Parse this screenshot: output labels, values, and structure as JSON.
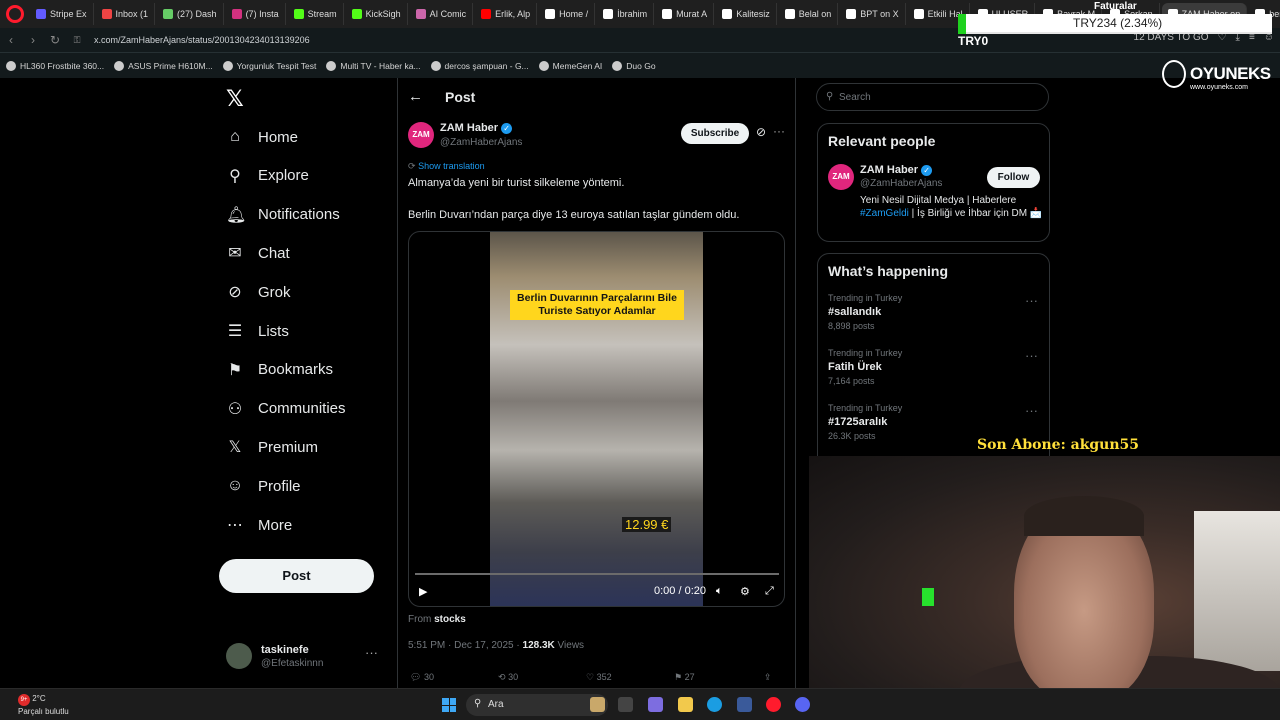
{
  "browser": {
    "tabs": [
      {
        "label": "Stripe Ex",
        "color": "#635bff"
      },
      {
        "label": "Inbox (1",
        "color": "#e44"
      },
      {
        "label": "(27) Dash",
        "color": "#6c6"
      },
      {
        "label": "(7) Insta",
        "color": "#d2317f"
      },
      {
        "label": "Stream",
        "color": "#53fc18"
      },
      {
        "label": "KickSigh",
        "color": "#53fc18"
      },
      {
        "label": "AI Comic",
        "color": "#c6a"
      },
      {
        "label": "Erlik, Alp",
        "color": "#f00"
      },
      {
        "label": "Home /",
        "color": "#fff"
      },
      {
        "label": "İbrahim",
        "color": "#fff"
      },
      {
        "label": "Murat A",
        "color": "#fff"
      },
      {
        "label": "Kalitesiz",
        "color": "#fff"
      },
      {
        "label": "Belal on",
        "color": "#fff"
      },
      {
        "label": "BPT on X",
        "color": "#fff"
      },
      {
        "label": "Etkili Hal",
        "color": "#fff"
      },
      {
        "label": "ULUSER",
        "color": "#fff"
      },
      {
        "label": "Bayrak M",
        "color": "#fff"
      },
      {
        "label": "Serkan",
        "color": "#fff"
      },
      {
        "label": "ZAM Haber on",
        "color": "#fff"
      },
      {
        "label": "berkay",
        "color": "#fff"
      }
    ],
    "url": "x.com/ZamHaberAjans/status/2001304234013139206",
    "nav_right_text": "12 DAYS TO GO",
    "bookmarks": [
      "HL360 Frostbite 360...",
      "ASUS Prime H610M...",
      "Yorgunluk Tespit Test",
      "Multi TV - Haber ka...",
      "dercos şampuan - G...",
      "MemeGen AI",
      "Duo Go"
    ]
  },
  "overlay": {
    "stock": "TRY234 (2.34%)",
    "ticker_label": "TRY0",
    "faturalar": "Faturalar",
    "brand": "OYUNEKS",
    "brand_url": "www.oyuneks.com",
    "son_abone": "Son Abone: akgun55"
  },
  "sidebar": {
    "items": [
      {
        "label": "Home",
        "icon": "home-icon",
        "glyph": "⌂"
      },
      {
        "label": "Explore",
        "icon": "search-icon",
        "glyph": "⚲"
      },
      {
        "label": "Notifications",
        "icon": "bell-icon",
        "glyph": "🔔︎"
      },
      {
        "label": "Chat",
        "icon": "mail-icon",
        "glyph": "✉"
      },
      {
        "label": "Grok",
        "icon": "grok-icon",
        "glyph": "⊘"
      },
      {
        "label": "Lists",
        "icon": "list-icon",
        "glyph": "☰"
      },
      {
        "label": "Bookmarks",
        "icon": "bookmark-icon",
        "glyph": "⚑"
      },
      {
        "label": "Communities",
        "icon": "communities-icon",
        "glyph": "⚇"
      },
      {
        "label": "Premium",
        "icon": "x-logo-icon",
        "glyph": "𝕏"
      },
      {
        "label": "Profile",
        "icon": "person-icon",
        "glyph": "☺"
      },
      {
        "label": "More",
        "icon": "more-circle-icon",
        "glyph": "⋯"
      }
    ],
    "post_button": "Post",
    "account": {
      "name": "taskinefe",
      "handle": "@Efetaskinnn"
    }
  },
  "post": {
    "header": "Post",
    "author_name": "ZAM Haber",
    "author_avatar_text": "ZAM",
    "author_handle": "@ZamHaberAjans",
    "subscribe_label": "Subscribe",
    "show_translation": "Show translation",
    "text_line1": "Almanya’da yeni bir turist silkeleme yöntemi.",
    "text_line2": "Berlin Duvarı’ndan parça diye 13 euroya satılan taşlar gündem oldu.",
    "video_caption": "Berlin Duvarının Parçalarını Bile Turiste Satıyor Adamlar",
    "video_price": "12.99 €",
    "video_time": "0:00 / 0:20",
    "from_prefix": "From",
    "from_source": "stocks",
    "time": "5:51 PM · Dec 17, 2025 ·",
    "views_count": "128.3K",
    "views_label": "Views",
    "replies": "30",
    "reposts": "30",
    "likes": "352",
    "bookmarks": "27"
  },
  "right": {
    "search_placeholder": "Search",
    "relevant_title": "Relevant people",
    "relevant": {
      "name": "ZAM Haber",
      "handle": "@ZamHaberAjans",
      "follow": "Follow",
      "bio_before": "Yeni Nesil Dijital Medya | Haberlere ",
      "bio_link": "#ZamGeldi",
      "bio_after": " | İş Birliği ve İhbar için DM 📩"
    },
    "happening_title": "What’s happening",
    "trends": [
      {
        "context": "Trending in Turkey",
        "name": "#sallandık",
        "posts": "8,898 posts"
      },
      {
        "context": "Trending in Turkey",
        "name": "Fatih Ürek",
        "posts": "7,164 posts"
      },
      {
        "context": "Trending in Turkey",
        "name": "#1725aralık",
        "posts": "26.3K posts"
      }
    ]
  },
  "taskbar": {
    "badge": "9+",
    "temp": "2°C",
    "weather": "Parçalı bulutlu",
    "search": "Ara"
  }
}
